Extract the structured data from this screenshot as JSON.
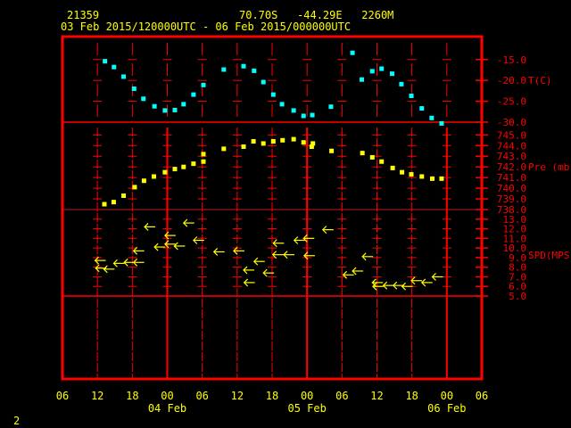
{
  "header": {
    "station_id": "21359",
    "location": "70.70S   -44.29E   2260M",
    "period": "03 Feb 2015/120000UTC - 06 Feb 2015/000000UTC"
  },
  "footer": {
    "page_number": "2"
  },
  "colors": {
    "frame": "#ff0000",
    "text": "#ffff00",
    "temperature": "#00ffff",
    "pressure": "#ffff00",
    "wind": "#ffff00"
  },
  "chart_data": {
    "type": "scatter",
    "x_axis": {
      "unit": "hours since 03 Feb 06UTC",
      "range": [
        0,
        72
      ],
      "tick_labels": [
        "06",
        "12",
        "18",
        "00",
        "06",
        "12",
        "18",
        "00",
        "06",
        "12",
        "18",
        "00",
        "06"
      ],
      "date_labels": [
        {
          "label": "04 Feb",
          "hour": 18
        },
        {
          "label": "05 Feb",
          "hour": 42
        },
        {
          "label": "06 Feb",
          "hour": 66
        }
      ]
    },
    "panels": [
      {
        "name": "temperature",
        "ylabel": "T(C)",
        "ylim": [
          -30,
          -9.5
        ],
        "ticks": [
          -15,
          -20,
          -25,
          -30
        ],
        "tick_labels": [
          "-15.0",
          "-20.0",
          "-25.0",
          "-30.0"
        ],
        "points": [
          [
            7.3,
            -15.4
          ],
          [
            8.85,
            -16.8
          ],
          [
            10.5,
            -19.1
          ],
          [
            12.3,
            -22.0
          ],
          [
            13.9,
            -24.4
          ],
          [
            15.8,
            -26.2
          ],
          [
            17.6,
            -27.2
          ],
          [
            19.3,
            -27.1
          ],
          [
            20.8,
            -25.7
          ],
          [
            22.5,
            -23.4
          ],
          [
            24.2,
            -21.1
          ],
          [
            27.7,
            -17.4
          ],
          [
            31.1,
            -16.6
          ],
          [
            32.9,
            -17.7
          ],
          [
            34.5,
            -20.4
          ],
          [
            36.2,
            -23.4
          ],
          [
            37.7,
            -25.7
          ],
          [
            39.7,
            -27.2
          ],
          [
            41.4,
            -28.5
          ],
          [
            42.9,
            -28.3
          ],
          [
            46.1,
            -26.3
          ],
          [
            49.8,
            -13.4
          ],
          [
            51.4,
            -19.8
          ],
          [
            53.2,
            -17.8
          ],
          [
            54.8,
            -17.2
          ],
          [
            56.6,
            -18.4
          ],
          [
            58.2,
            -20.9
          ],
          [
            59.9,
            -23.7
          ],
          [
            61.7,
            -26.7
          ],
          [
            63.4,
            -29.0
          ],
          [
            65.1,
            -30.3
          ]
        ]
      },
      {
        "name": "pressure",
        "ylabel": "Pre (mb)",
        "ylim": [
          738,
          746.2
        ],
        "ticks": [
          745,
          744,
          743,
          742,
          741,
          740,
          739,
          738
        ],
        "tick_labels": [
          "745.0",
          "744.0",
          "743.0",
          "742.0",
          "741.0",
          "740.0",
          "739.0",
          "738.0"
        ],
        "points": [
          [
            7.2,
            738.5
          ],
          [
            8.8,
            738.7
          ],
          [
            10.5,
            739.3
          ],
          [
            12.4,
            740.1
          ],
          [
            14.0,
            740.7
          ],
          [
            15.7,
            741.1
          ],
          [
            17.6,
            741.5
          ],
          [
            19.3,
            741.8
          ],
          [
            20.8,
            742.0
          ],
          [
            22.5,
            742.3
          ],
          [
            24.2,
            743.2
          ],
          [
            24.2,
            742.5
          ],
          [
            27.7,
            743.7
          ],
          [
            31.1,
            743.9
          ],
          [
            32.8,
            744.4
          ],
          [
            34.5,
            744.2
          ],
          [
            36.2,
            744.4
          ],
          [
            37.8,
            744.5
          ],
          [
            39.7,
            744.6
          ],
          [
            41.4,
            744.3
          ],
          [
            43.0,
            744.2
          ],
          [
            42.8,
            743.9
          ],
          [
            46.2,
            743.5
          ],
          [
            51.5,
            743.3
          ],
          [
            53.2,
            742.9
          ],
          [
            54.8,
            742.5
          ],
          [
            56.7,
            741.9
          ],
          [
            58.3,
            741.5
          ],
          [
            59.9,
            741.3
          ],
          [
            61.7,
            741.1
          ],
          [
            63.5,
            740.9
          ],
          [
            65.1,
            740.9
          ]
        ]
      },
      {
        "name": "wind_speed",
        "ylabel": "SPD(MPS)",
        "ylim": [
          5,
          14
        ],
        "ticks": [
          13,
          12,
          11,
          10,
          9,
          8,
          7,
          6,
          5
        ],
        "tick_labels": [
          "13.0",
          "12.0",
          "11.0",
          "10.0",
          "9.0",
          "8.0",
          "7.0",
          "6.0",
          "5.0"
        ],
        "arrow_direction": "east wind (arrows point west)",
        "points": [
          [
            5.6,
            8.7
          ],
          [
            5.7,
            7.9
          ],
          [
            7.1,
            7.8
          ],
          [
            8.8,
            8.4
          ],
          [
            10.6,
            8.5
          ],
          [
            12.2,
            8.5
          ],
          [
            12.2,
            9.7
          ],
          [
            14.1,
            12.2
          ],
          [
            15.8,
            10.1
          ],
          [
            17.6,
            11.3
          ],
          [
            17.6,
            10.4
          ],
          [
            19.2,
            10.2
          ],
          [
            20.8,
            12.6
          ],
          [
            22.5,
            10.8
          ],
          [
            26.0,
            9.6
          ],
          [
            29.4,
            9.7
          ],
          [
            31.1,
            7.7
          ],
          [
            31.2,
            6.4
          ],
          [
            32.9,
            8.6
          ],
          [
            34.5,
            7.4
          ],
          [
            36.2,
            10.5
          ],
          [
            36.1,
            9.3
          ],
          [
            38.0,
            9.3
          ],
          [
            39.8,
            10.8
          ],
          [
            41.4,
            11.0
          ],
          [
            41.5,
            9.2
          ],
          [
            44.7,
            11.9
          ],
          [
            48.2,
            7.2
          ],
          [
            49.8,
            7.6
          ],
          [
            51.5,
            9.1
          ],
          [
            53.2,
            6.4
          ],
          [
            53.3,
            6.0
          ],
          [
            55.1,
            6.1
          ],
          [
            56.8,
            6.1
          ],
          [
            58.3,
            6.0
          ],
          [
            59.9,
            6.6
          ],
          [
            61.7,
            6.4
          ],
          [
            63.5,
            7.0
          ]
        ]
      }
    ]
  }
}
